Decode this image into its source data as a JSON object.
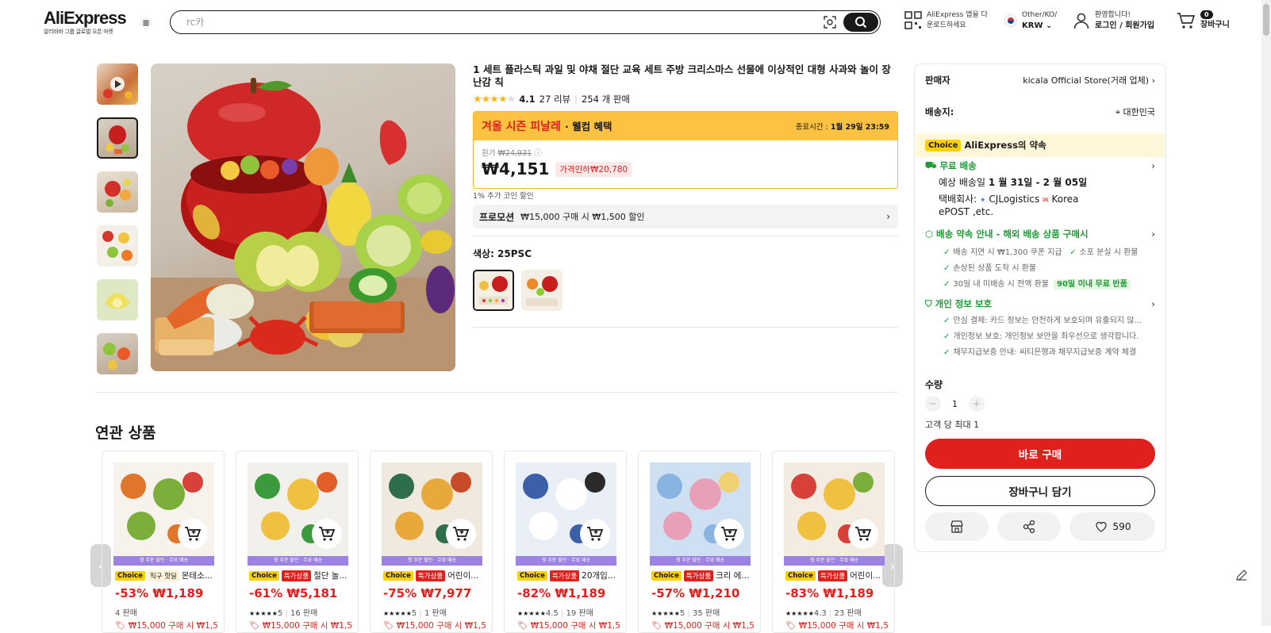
{
  "header": {
    "logo": "AliExpress",
    "logo_sub": "알리바바 그룹 글로벌 오픈 마켓",
    "search_value": "rc카",
    "app_line1": "AliExpress 앱을 다",
    "app_line2": "운로드하세요",
    "locale_line1": "Other/KO/",
    "locale_line2": "KRW",
    "account_line1": "환영합니다!",
    "account_line2": "로그인 / 회원가입",
    "cart_count": "0",
    "cart_label": "장바구니"
  },
  "product": {
    "title": "1 세트 플라스틱 과일 및 야채 절단 교육 세트 주방 크리스마스 선물에 이상적인 대형 사과와 놀이 장난감 칙",
    "rating": 4.1,
    "rating_text": "4.1",
    "reviews": "27 리뷰",
    "sold": "254 개 판매",
    "sale_name": "겨울 시즌 피날레",
    "sale_welcome": "· 웰컴 혜택",
    "sale_end_label": "종료시간 :",
    "sale_end_value": "1월 29일 23:59",
    "orig_label": "원가",
    "orig_price": "₩24,931",
    "price": "₩4,151",
    "price_drop": "가격인하₩20,780",
    "coin_discount": "1% 추가 코인 할인",
    "promo_label": "프로모션",
    "promo_text": "₩15,000 구매 시 ₩1,500 할인",
    "color_label": "색상: 25PSC"
  },
  "sidebar": {
    "seller_label": "판매자",
    "seller_value": "kicala Official Store(거래 업체)",
    "shipto_label": "배송지:",
    "shipto_value": "대한민국",
    "choice_tag": "Choice",
    "choice_text": "AliExpress의 약속",
    "free_ship": "무료 배송",
    "est_label": "예상 배송일",
    "est_value": "1 월 31일 - 2 월 05일",
    "carrier_label": "택배회사:",
    "carrier_1": "CJLogistics",
    "carrier_2": "Korea",
    "carrier_3": "ePOST ,etc.",
    "guide_title": "배송 약속 안내 - 해외 배송 상품 구매시",
    "guide_1": "배송 지연 시 ₩1,300 쿠폰 지급",
    "guide_2": "소포 분실 시 환불",
    "guide_3": "손상된 상품 도착 시 환불",
    "guide_4": "30일 내 미배송 시 전액 환불",
    "guide_4_tag": "90일 이내 무료 반품",
    "privacy_title": "개인 정보 보호",
    "privacy_1": "안심 결제: 카드 정보는 안전하게 보호되며 유출되지 않...",
    "privacy_2": "개인정보 보호: 개인정보 보안을 최우선으로 생각합니다.",
    "privacy_3": "채무지급보증 안내: 씨티은행과 채무지급보증 계약 체결",
    "qty_label": "수량",
    "qty_value": "1",
    "qty_max": "고객 당 최대 1",
    "buy_now": "바로 구매",
    "add_cart": "장바구니 담기",
    "wish_count": "590"
  },
  "related": {
    "title": "연관 상품",
    "band_text": "첫 주문 할인 · 무료 배송",
    "items": [
      {
        "tag1": "Choice",
        "tag2": "직구 핫딜",
        "name": "몬테소...",
        "price": "-53% ₩1,189",
        "rating": "",
        "sold": "4 판매",
        "promo": "₩15,000 구매 시 ₩1,5"
      },
      {
        "tag1": "Choice",
        "tag2": "특가상품",
        "name": "절단 놀...",
        "price": "-61% ₩5,181",
        "rating": "5",
        "sold": "16 판매",
        "promo": "₩15,000 구매 시 ₩1,5"
      },
      {
        "tag1": "Choice",
        "tag2": "특가상품",
        "name": "어린이...",
        "price": "-75% ₩7,977",
        "rating": "5",
        "sold": "1 판매",
        "promo": "₩15,000 구매 시 ₩1,5"
      },
      {
        "tag1": "Choice",
        "tag2": "특가상품",
        "name": "20개입...",
        "price": "-82% ₩1,189",
        "rating": "4.5",
        "sold": "19 판매",
        "promo": "₩15,000 구매 시 ₩1,5"
      },
      {
        "tag1": "Choice",
        "tag2": "특가상품",
        "name": "크리 에...",
        "price": "-57% ₩1,210",
        "rating": "5",
        "sold": "35 판매",
        "promo": "₩15,000 구매 시 ₩1,5"
      },
      {
        "tag1": "Choice",
        "tag2": "특가상품",
        "name": "어린이...",
        "price": "-83% ₩1,189",
        "rating": "4.3",
        "sold": "23 판매",
        "promo": "₩15,000 구매 시 ₩1,5"
      }
    ]
  },
  "colors": {
    "accent": "#e0201c",
    "sale_bg": "#fdc340",
    "green": "#1d9a34",
    "choice": "#fdd000"
  }
}
